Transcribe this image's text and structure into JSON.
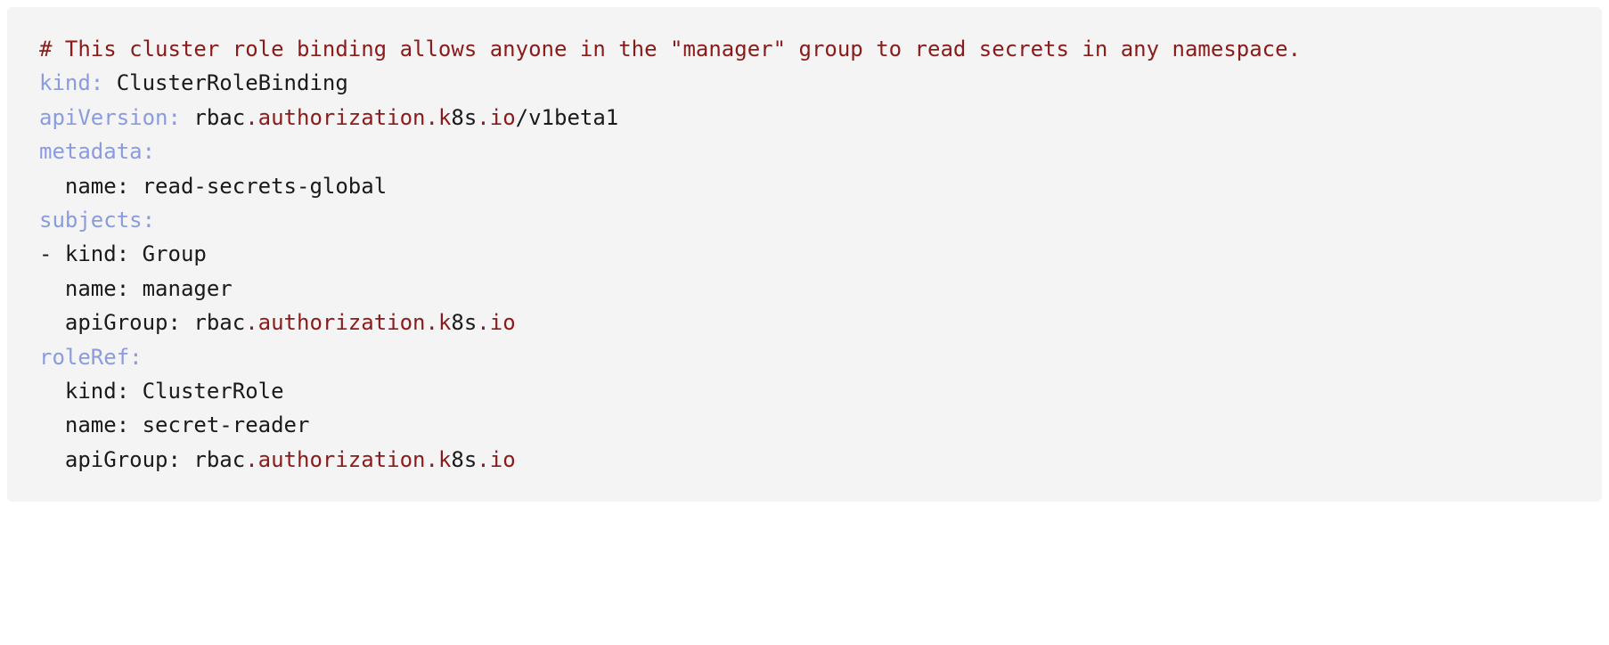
{
  "code": {
    "comment": "# This cluster role binding allows anyone in the \"manager\" group to read secrets in any namespace.",
    "k_kind": "kind",
    "v_kind": "ClusterRoleBinding",
    "k_apiVersion": "apiVersion",
    "v_apiVersion_pre": "rbac",
    "v_apiVersion_mid": ".authorization.k",
    "v_apiVersion_post": "8s",
    "v_apiVersion_io": ".io",
    "v_apiVersion_slash": "/v1beta1",
    "k_metadata": "metadata",
    "k_meta_name": "name",
    "v_meta_name": "read-secrets-global",
    "k_subjects": "subjects",
    "dash": "-",
    "k_sub_kind": "kind",
    "v_sub_kind": "Group",
    "k_sub_name": "name",
    "v_sub_name": "manager",
    "k_sub_apiGroup": "apiGroup",
    "v_apiGroup_pre": "rbac",
    "v_apiGroup_mid": ".authorization.k",
    "v_apiGroup_post": "8s",
    "v_apiGroup_io": ".io",
    "k_roleRef": "roleRef",
    "k_rr_kind": "kind",
    "v_rr_kind": "ClusterRole",
    "k_rr_name": "name",
    "v_rr_name": "secret-reader",
    "k_rr_apiGroup": "apiGroup",
    "colon": ":",
    "space": " "
  }
}
